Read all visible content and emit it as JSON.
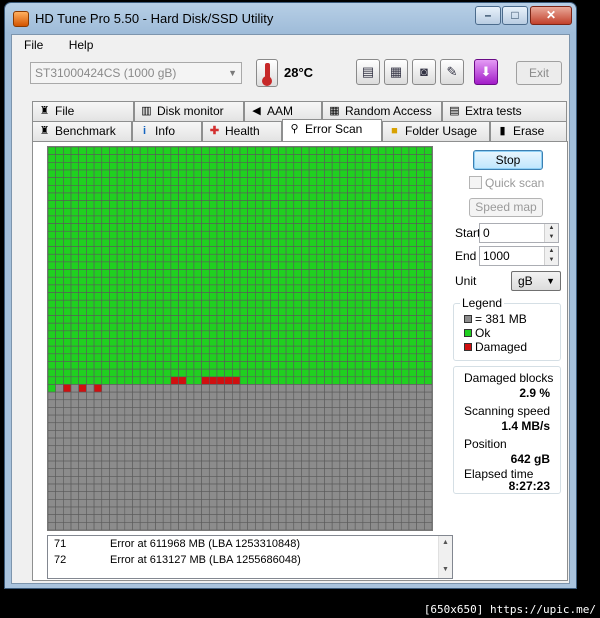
{
  "window": {
    "title": "HD Tune Pro 5.50 - Hard Disk/SSD Utility",
    "minimize": "–",
    "maximize": "□",
    "close": "✕"
  },
  "menu": {
    "file": "File",
    "help": "Help"
  },
  "toolbar": {
    "drive": "ST31000424CS (1000 gB)",
    "temperature": "28",
    "temperature_unit": "°C",
    "exit_label": "Exit",
    "buttons": [
      "copy-text-icon",
      "copy-info-icon",
      "screenshot-icon",
      "options-icon",
      "save-icon"
    ]
  },
  "tabs": {
    "top": [
      "File Benchmark",
      "Disk monitor",
      "AAM",
      "Random Access",
      "Extra tests"
    ],
    "bottom": [
      "Benchmark",
      "Info",
      "Health",
      "Error Scan",
      "Folder Usage",
      "Erase"
    ],
    "active": "Error Scan"
  },
  "controls": {
    "stop_label": "Stop",
    "quick_scan_label": "Quick scan",
    "speed_map_label": "Speed map",
    "start_label": "Start",
    "start_value": "0",
    "end_label": "End",
    "end_value": "1000",
    "unit_label": "Unit",
    "unit_value": "gB"
  },
  "legend": {
    "title": "Legend",
    "block": "= 381 MB",
    "ok": "Ok",
    "damaged": "Damaged"
  },
  "stats": {
    "damaged_blocks_label": "Damaged blocks",
    "damaged_blocks_value": "2.9 %",
    "scanning_speed_label": "Scanning speed",
    "scanning_speed_value": "1.4 MB/s",
    "position_label": "Position",
    "position_value": "642 gB",
    "elapsed_label": "Elapsed time",
    "elapsed_value": "8:27:23"
  },
  "scan_grid": {
    "columns": 50,
    "rows": 50,
    "scanned_full_rows": 31,
    "colors": {
      "ok": "#20d020",
      "damaged": "#d01010",
      "unscanned": "#8c8c8c",
      "line": "#5a5a5a"
    },
    "damaged_cells": [
      [
        31,
        2
      ],
      [
        31,
        4
      ],
      [
        31,
        6
      ],
      [
        30,
        16
      ],
      [
        30,
        17
      ],
      [
        30,
        20
      ],
      [
        30,
        21
      ],
      [
        30,
        22
      ],
      [
        30,
        23
      ],
      [
        30,
        24
      ]
    ]
  },
  "log": [
    {
      "n": "71",
      "msg": "Error at 611968 MB (LBA 1253310848)"
    },
    {
      "n": "72",
      "msg": "Error at 613127 MB (LBA 1255686048)"
    }
  ],
  "watermark": "[650x650] https://upic.me/"
}
